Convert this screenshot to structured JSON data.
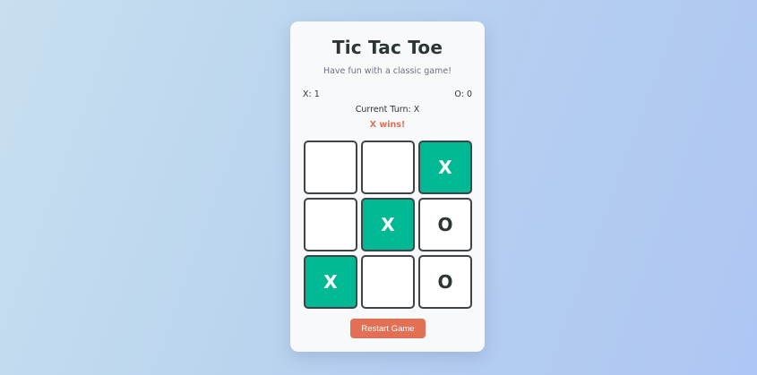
{
  "game": {
    "title": "Tic Tac Toe",
    "subtitle": "Have fun with a classic game!",
    "score_x": "X: 1",
    "score_o": "O: 0",
    "current_turn": "Current Turn: X",
    "status": "X wins!",
    "restart_label": "Restart Game"
  },
  "board": {
    "cells": [
      "",
      "",
      "X",
      "",
      "X",
      "O",
      "X",
      "",
      "O"
    ],
    "winning_cells": [
      2,
      4,
      6
    ]
  },
  "colors": {
    "win_highlight": "#00b894",
    "accent": "#e17055",
    "text": "#2d3436"
  }
}
